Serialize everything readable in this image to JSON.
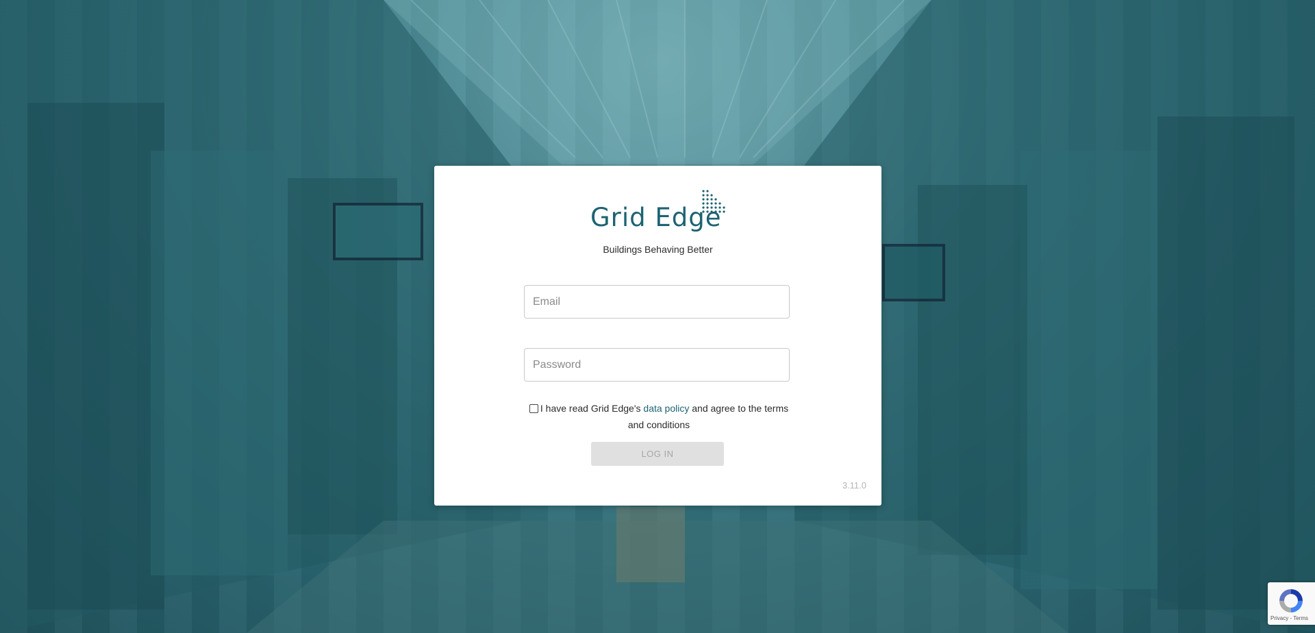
{
  "background": {
    "description_colors": {
      "tint": "#2a6570"
    }
  },
  "brand": {
    "name": "Grid Edge",
    "tagline": "Buildings Behaving Better",
    "color": "#1d6372"
  },
  "form": {
    "email_placeholder": "Email",
    "password_placeholder": "Password",
    "consent_prefix": "I have read Grid Edge's ",
    "consent_link": "data policy",
    "consent_suffix": " and agree to the terms and conditions",
    "consent_checked": false,
    "login_label": "LOG IN",
    "login_enabled": false
  },
  "version": "3.11.0",
  "recaptcha": {
    "privacy": "Privacy",
    "separator": " - ",
    "terms": "Terms"
  }
}
